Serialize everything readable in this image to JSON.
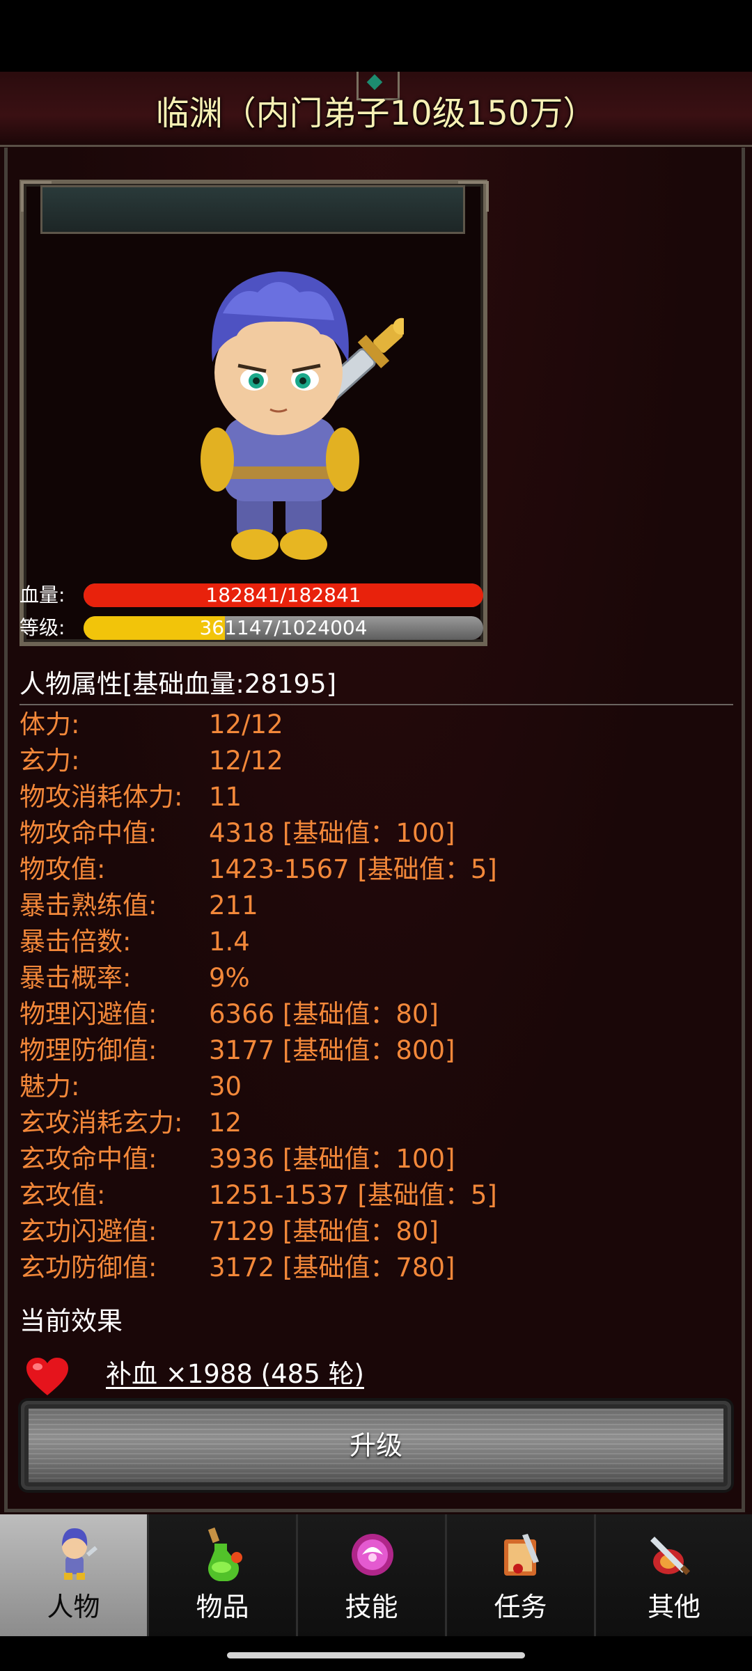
{
  "header": {
    "title": "临渊（内门弟子10级150万）"
  },
  "portrait": {
    "hp_label": "血量:",
    "hp_text": "182841/182841",
    "hp_fraction": 1.0,
    "hp_color": "#e8220c",
    "level_label": "等级:",
    "level_text": "361147/1024004",
    "level_fraction": 0.353,
    "level_color": "#f2c40a"
  },
  "attributes": {
    "heading": "人物属性[基础血量:28195]",
    "rows": [
      {
        "name": "体力:",
        "value": "12/12"
      },
      {
        "name": "玄力:",
        "value": "12/12"
      },
      {
        "name": "物攻消耗体力:",
        "value": "11"
      },
      {
        "name": "物攻命中值:",
        "value": "4318 [基础值：100]"
      },
      {
        "name": "物攻值:",
        "value": "1423-1567 [基础值：5]"
      },
      {
        "name": "暴击熟练值:",
        "value": "211"
      },
      {
        "name": "暴击倍数:",
        "value": "1.4"
      },
      {
        "name": "暴击概率:",
        "value": "9%"
      },
      {
        "name": "物理闪避值:",
        "value": "6366 [基础值：80]"
      },
      {
        "name": "物理防御值:",
        "value": "3177 [基础值：800]"
      },
      {
        "name": "魅力:",
        "value": "30"
      },
      {
        "name": "玄攻消耗玄力:",
        "value": "12"
      },
      {
        "name": "玄攻命中值:",
        "value": "3936 [基础值：100]"
      },
      {
        "name": "玄攻值:",
        "value": "1251-1537 [基础值：5]"
      },
      {
        "name": "玄功闪避值:",
        "value": "7129 [基础值：80]"
      },
      {
        "name": "玄功防御值:",
        "value": "3172 [基础值：780]"
      }
    ]
  },
  "effects": {
    "heading": "当前效果",
    "items": [
      {
        "icon": "heart-icon",
        "text": "补血 ×1988 (485 轮)"
      }
    ]
  },
  "upgrade_label": "升级",
  "tabs": [
    {
      "label": "人物",
      "icon": "character-icon",
      "active": true
    },
    {
      "label": "物品",
      "icon": "potion-icon",
      "active": false
    },
    {
      "label": "技能",
      "icon": "skill-orb-icon",
      "active": false
    },
    {
      "label": "任务",
      "icon": "quest-scroll-icon",
      "active": false
    },
    {
      "label": "其他",
      "icon": "sword-shield-icon",
      "active": false
    }
  ]
}
